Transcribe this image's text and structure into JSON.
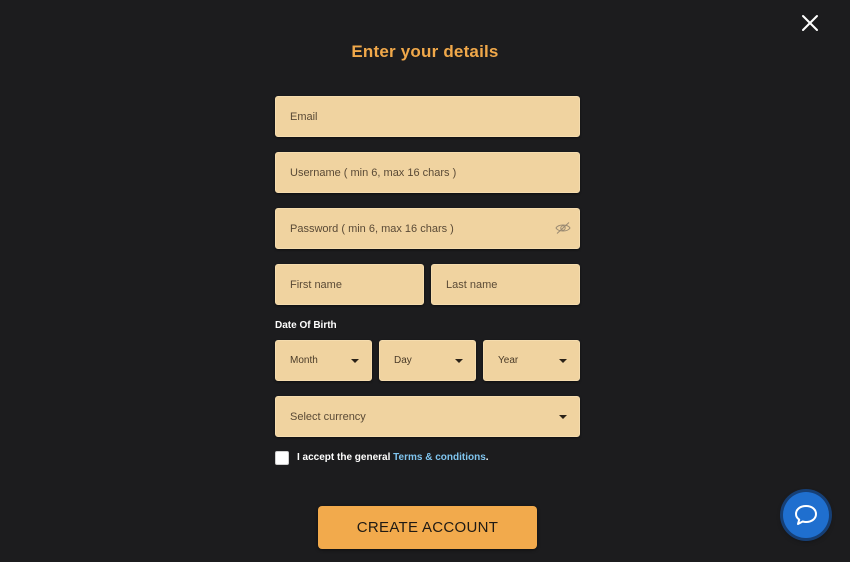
{
  "title": "Enter your details",
  "fields": {
    "email_placeholder": "Email",
    "username_placeholder": "Username ( min 6, max 16 chars )",
    "password_placeholder": "Password ( min 6, max 16 chars )",
    "first_name_placeholder": "First name",
    "last_name_placeholder": "Last name"
  },
  "dob": {
    "label": "Date Of Birth",
    "month": "Month",
    "day": "Day",
    "year": "Year"
  },
  "currency": {
    "selected": "Select currency"
  },
  "terms": {
    "prefix": "I accept the general ",
    "link": "Terms & conditions",
    "suffix": "."
  },
  "submit_label": "CREATE ACCOUNT",
  "icons": {
    "close": "close-icon",
    "password_toggle": "eye-icon",
    "dropdown": "chevron-down-icon",
    "chat": "chat-bubble-icon"
  },
  "colors": {
    "background": "#1c1c1e",
    "title": "#f0a84a",
    "field": "#f0d3a0",
    "button": "#f2aa4c",
    "link": "#7fc4ee",
    "chat": "#1f6fcf"
  }
}
